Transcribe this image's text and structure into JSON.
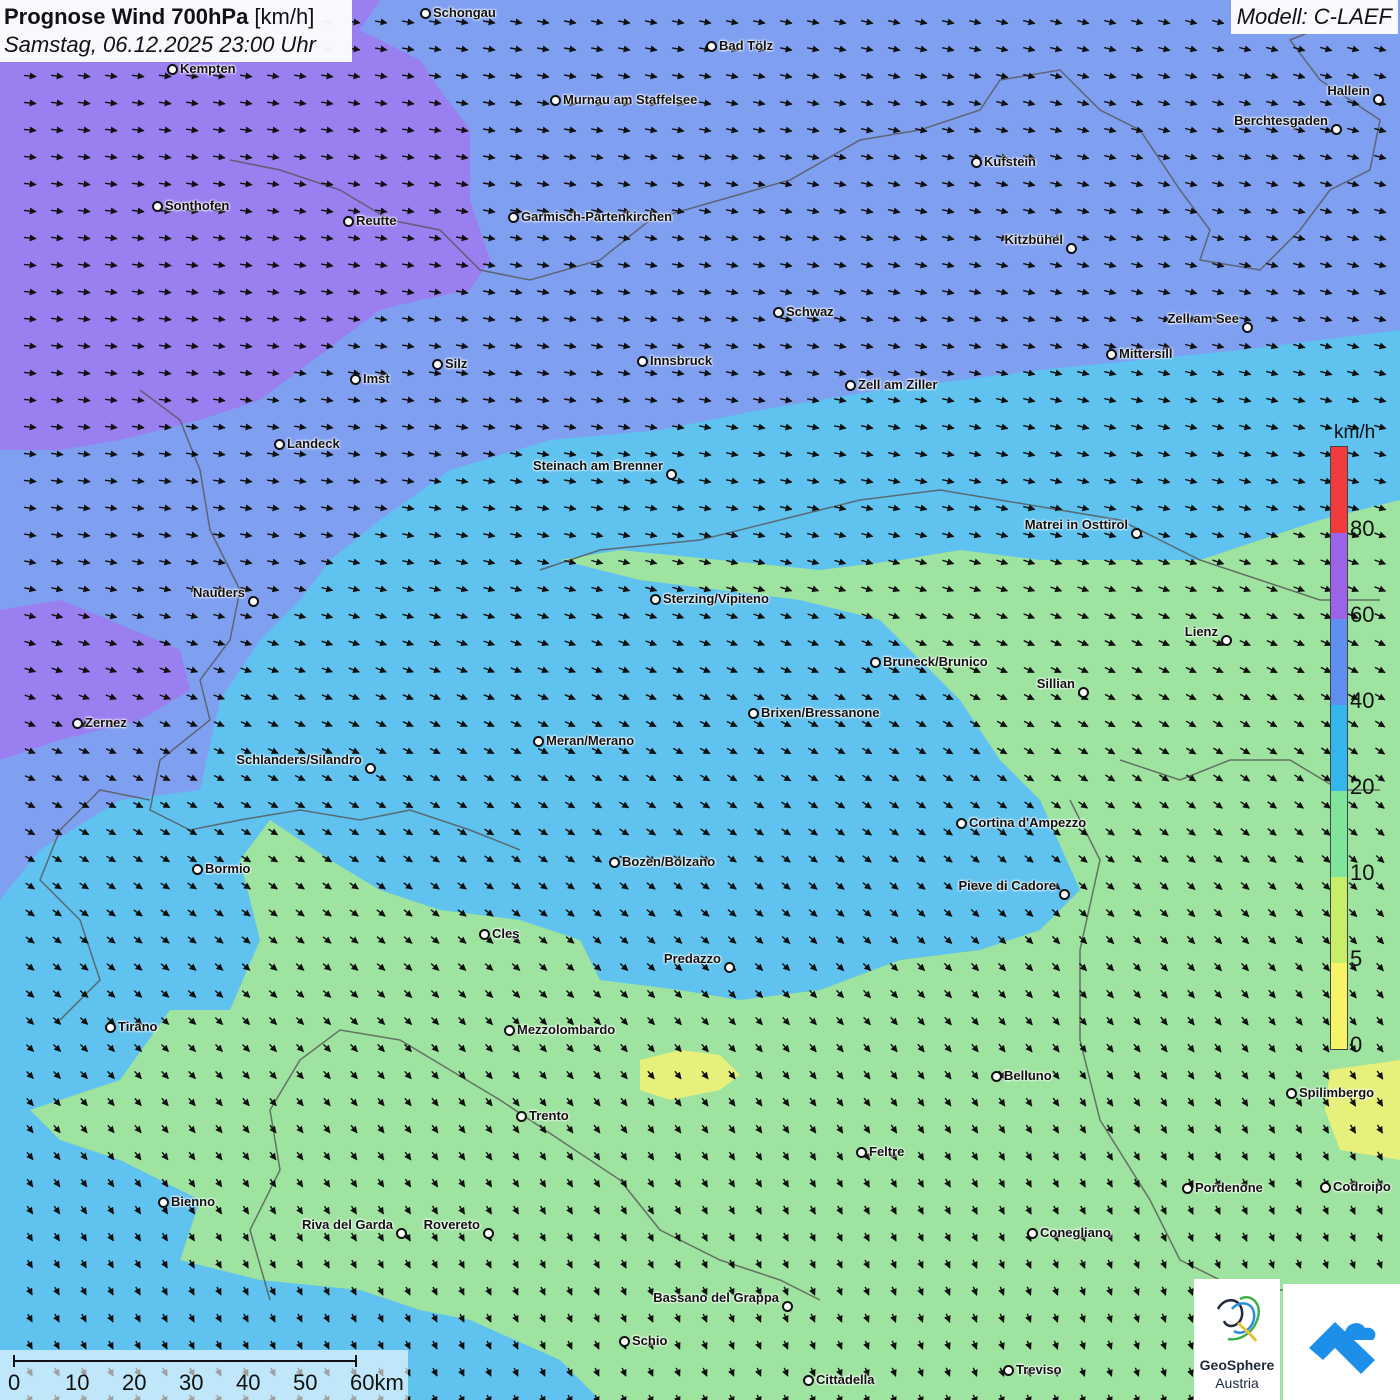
{
  "header": {
    "title_bold": "Prognose Wind 700hPa",
    "title_unit": " [km/h]",
    "datetime": "Samstag, 06.12.2025 23:00 Uhr",
    "model": "Modell: C-LAEF"
  },
  "legend": {
    "unit": "km/h",
    "ticks": [
      "80",
      "60",
      "40",
      "20",
      "10",
      "5",
      "0"
    ],
    "colors": {
      "above_80": "#f03c3c",
      "60_80": "#9a63e8",
      "40_60": "#5f8ff0",
      "20_40": "#32b6ec",
      "10_20": "#80e49a",
      "5_10": "#c6ee68",
      "0_5": "#f6f466"
    }
  },
  "field_colors": {
    "purple": "#9a7ff0",
    "blue": "#7f9ff0",
    "cyan": "#60c2ef",
    "green": "#9ee39f",
    "yellow": "#e6f07a"
  },
  "cities": [
    {
      "name": "Schongau",
      "label_pos": "right"
    },
    {
      "name": "Bad Tölz",
      "label_pos": "right"
    },
    {
      "name": "Kempten",
      "label_pos": "right"
    },
    {
      "name": "Murnau am Staffelsee",
      "label_pos": "right"
    },
    {
      "name": "Hallein",
      "label_pos": "left"
    },
    {
      "name": "Berchtesgaden",
      "label_pos": "left"
    },
    {
      "name": "Kufstein",
      "label_pos": "right"
    },
    {
      "name": "Sonthofen",
      "label_pos": "right"
    },
    {
      "name": "Reutte",
      "label_pos": "right"
    },
    {
      "name": "Garmisch-Partenkirchen",
      "label_pos": "right"
    },
    {
      "name": "Kitzbühel",
      "label_pos": "left"
    },
    {
      "name": "Schwaz",
      "label_pos": "right"
    },
    {
      "name": "Zell am See",
      "label_pos": "left"
    },
    {
      "name": "Mittersill",
      "label_pos": "right"
    },
    {
      "name": "Innsbruck",
      "label_pos": "right"
    },
    {
      "name": "Silz",
      "label_pos": "right"
    },
    {
      "name": "Imst",
      "label_pos": "right"
    },
    {
      "name": "Zell am Ziller",
      "label_pos": "right"
    },
    {
      "name": "Landeck",
      "label_pos": "right"
    },
    {
      "name": "Steinach am Brenner",
      "label_pos": "left"
    },
    {
      "name": "Matrei in Osttirol",
      "label_pos": "left"
    },
    {
      "name": "Nauders",
      "label_pos": "left"
    },
    {
      "name": "Sterzing/Vipiteno",
      "label_pos": "right"
    },
    {
      "name": "Lienz",
      "label_pos": "left"
    },
    {
      "name": "Bruneck/Brunico",
      "label_pos": "right"
    },
    {
      "name": "Sillian",
      "label_pos": "left"
    },
    {
      "name": "Brixen/Bressanone",
      "label_pos": "right"
    },
    {
      "name": "Zernez",
      "label_pos": "right"
    },
    {
      "name": "Meran/Merano",
      "label_pos": "right"
    },
    {
      "name": "Schlanders/Silandro",
      "label_pos": "left"
    },
    {
      "name": "Cortina d'Ampezzo",
      "label_pos": "right"
    },
    {
      "name": "Bozen/Bolzano",
      "label_pos": "right"
    },
    {
      "name": "Bormio",
      "label_pos": "right"
    },
    {
      "name": "Pieve di Cadore",
      "label_pos": "left"
    },
    {
      "name": "Cles",
      "label_pos": "right"
    },
    {
      "name": "Predazzo",
      "label_pos": "left"
    },
    {
      "name": "Tirano",
      "label_pos": "right"
    },
    {
      "name": "Mezzolombardo",
      "label_pos": "right"
    },
    {
      "name": "Belluno",
      "label_pos": "right"
    },
    {
      "name": "Spilimbergo",
      "label_pos": "right"
    },
    {
      "name": "Trento",
      "label_pos": "right"
    },
    {
      "name": "Feltre",
      "label_pos": "right"
    },
    {
      "name": "Pordenone",
      "label_pos": "right"
    },
    {
      "name": "Codroipo",
      "label_pos": "right"
    },
    {
      "name": "Bienno",
      "label_pos": "right"
    },
    {
      "name": "Riva del Garda",
      "label_pos": "left"
    },
    {
      "name": "Rovereto",
      "label_pos": "left"
    },
    {
      "name": "Conegliano",
      "label_pos": "right"
    },
    {
      "name": "Bassano del Grappa",
      "label_pos": "left"
    },
    {
      "name": "Schio",
      "label_pos": "right"
    },
    {
      "name": "Treviso",
      "label_pos": "right"
    },
    {
      "name": "Cittadella",
      "label_pos": "right"
    }
  ],
  "scale": {
    "ticks": [
      "0",
      "10",
      "20",
      "30",
      "40",
      "50",
      "60km"
    ]
  },
  "logos": {
    "geosphere_line1": "GeoSphere",
    "geosphere_line2": "Austria"
  }
}
